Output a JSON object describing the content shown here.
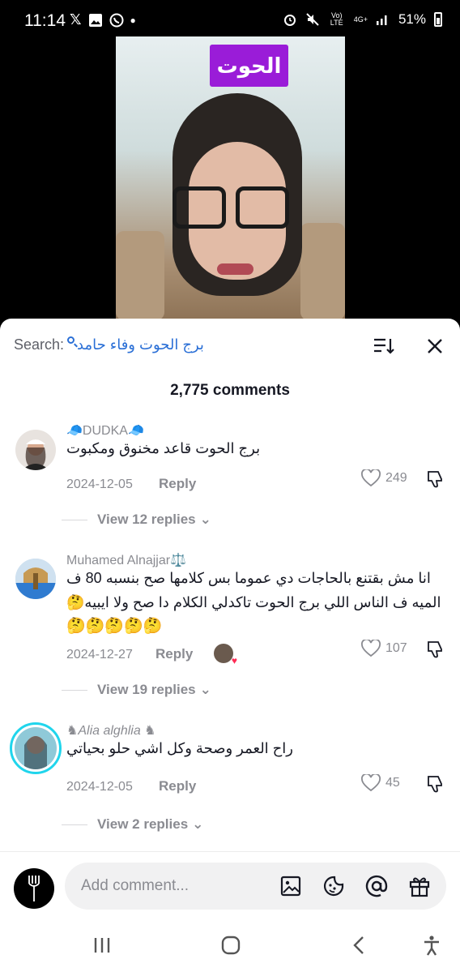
{
  "status_bar": {
    "time": "11:14",
    "left_icons": [
      "x-icon",
      "gallery-icon",
      "whatsapp-icon",
      "dot-icon"
    ],
    "volte": "Vo) LTE",
    "network": "4G+",
    "battery": "51%"
  },
  "video": {
    "tag_text": "الحوت",
    "tag_color": "#9a1cd8"
  },
  "sheet": {
    "search_label": "Search:",
    "search_query": "برج الحوت وفاء حامد",
    "comment_count": "2,775 comments"
  },
  "comments": [
    {
      "username": "DUDKA",
      "text": "برج الحوت قاعد مخنوق ومكبوت",
      "date": "2024-12-05",
      "reply_label": "Reply",
      "likes": "249",
      "view_replies": "View 12 replies"
    },
    {
      "username": "Muhamed Alnajjar⚖️",
      "text_line1": "انا مش بقتنع بالحاجات دي عموما بس كلامها صح بنسبه 80 ف",
      "text_line2": "الميه ف الناس اللي برج الحوت تاكدلي الكلام دا صح ولا ايبيه🤔",
      "text_line3": "🤔🤔🤔🤔🤔",
      "date": "2024-12-27",
      "reply_label": "Reply",
      "likes": "107",
      "view_replies": "View 19 replies"
    },
    {
      "username": "♞Alia alghlia ♞",
      "text": "راح العمر وصحة وكل اشي حلو بحياتي",
      "date": "2024-12-05",
      "reply_label": "Reply",
      "likes": "45",
      "view_replies": "View 2 replies"
    }
  ],
  "input": {
    "placeholder": "Add comment..."
  },
  "colors": {
    "accent_link": "#2a6fd6",
    "muted": "#8a8b91"
  }
}
